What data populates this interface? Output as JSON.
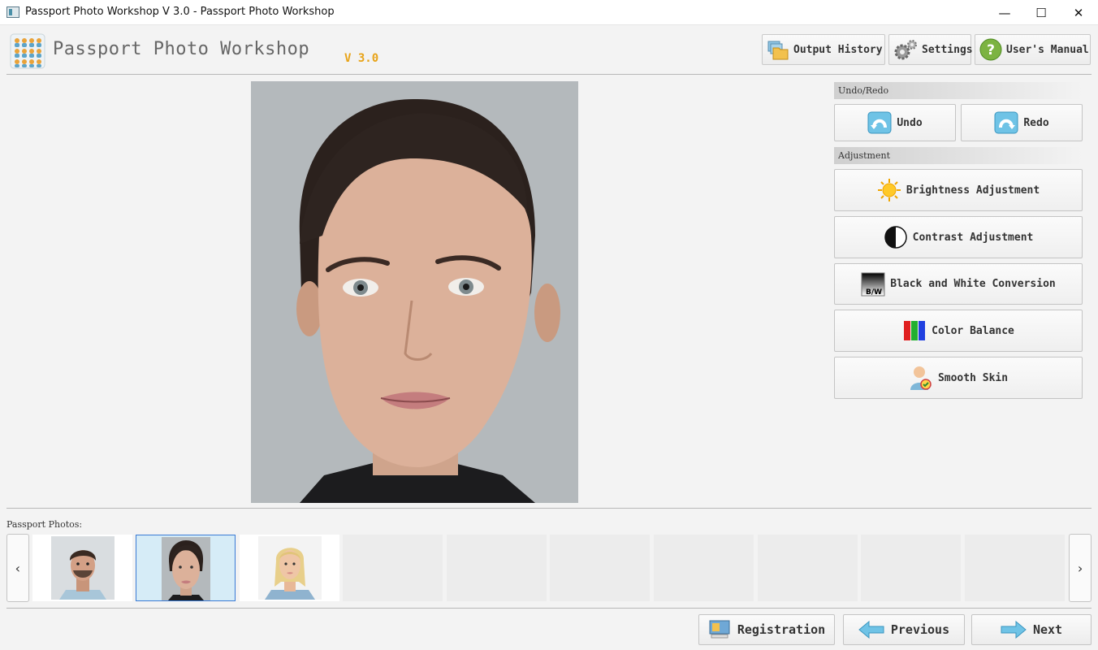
{
  "window": {
    "title": "Passport Photo Workshop V 3.0 - Passport Photo Workshop",
    "minimize": "—",
    "maximize": "☐",
    "close": "✕"
  },
  "header": {
    "app_name": "Passport Photo Workshop",
    "version": "V 3.0",
    "buttons": {
      "output_history": "Output History",
      "settings": "Settings",
      "users_manual": "User's Manual"
    }
  },
  "panel": {
    "undo_redo_label": "Undo/Redo",
    "undo": "Undo",
    "redo": "Redo",
    "adjustment_label": "Adjustment",
    "tools": [
      {
        "label": "Brightness Adjustment",
        "icon": "sun-icon"
      },
      {
        "label": "Contrast Adjustment",
        "icon": "contrast-icon"
      },
      {
        "label": "Black and White Conversion",
        "icon": "bw-icon"
      },
      {
        "label": "Color Balance",
        "icon": "rgb-bars-icon"
      },
      {
        "label": "Smooth Skin",
        "icon": "person-smooth-icon"
      }
    ],
    "bw_icon_text": "B/W"
  },
  "thumbnails": {
    "label": "Passport Photos:",
    "prev": "‹",
    "next": "›",
    "selected_index": 1
  },
  "footer": {
    "registration": "Registration",
    "previous": "Previous",
    "next": "Next"
  },
  "colors": {
    "version": "#e8a317",
    "selected_thumb_bg": "#d6ecf7",
    "selected_thumb_border": "#3a7bd5",
    "photo_bg": "#b3b8bb"
  }
}
